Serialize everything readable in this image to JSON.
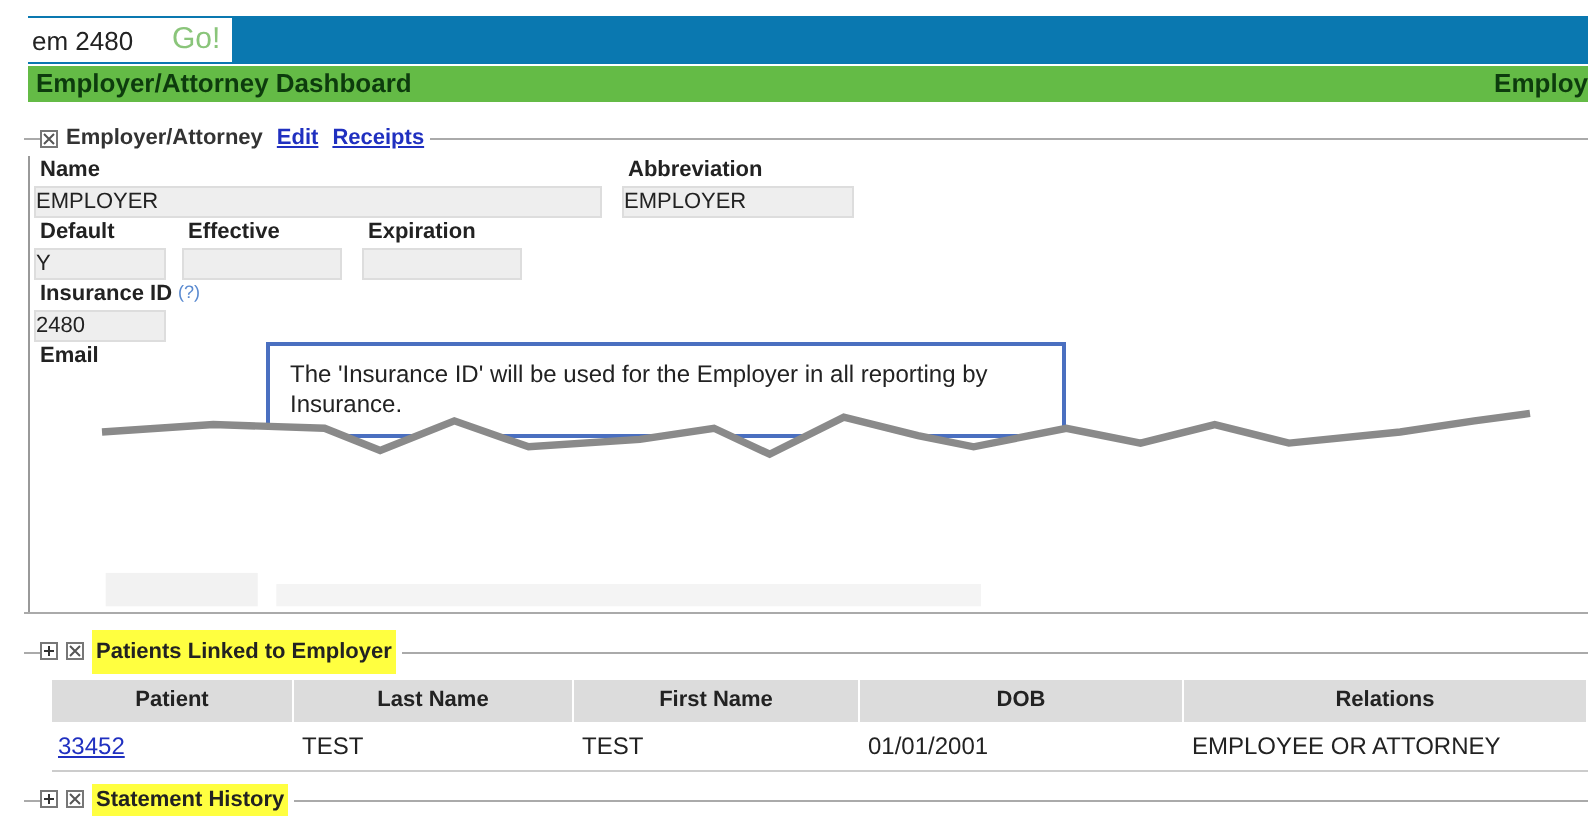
{
  "search": {
    "value": "em 2480",
    "button": "Go!"
  },
  "header": {
    "title": "Employer/Attorney Dashboard",
    "right_title": "Employ"
  },
  "employer_section": {
    "title": "Employer/Attorney",
    "links": [
      "Edit",
      "Receipts"
    ],
    "rows": [
      [
        {
          "kind": "field",
          "label": "Name",
          "value": "EMPLOYER"
        },
        {
          "kind": "field",
          "label": "Abbreviation",
          "value": "EMPLOYER"
        }
      ],
      [
        {
          "kind": "field",
          "label": "Default",
          "value": "Y"
        },
        {
          "kind": "field",
          "label": "Effective"
        },
        {
          "kind": "field",
          "label": "Expiration"
        }
      ],
      [
        {
          "kind": "field",
          "label": "Insurance ID",
          "help": "(?)",
          "value": "2480"
        }
      ],
      [
        {
          "kind": "label",
          "label": "Email"
        }
      ]
    ],
    "tooltip": "The 'Insurance ID' will be used for the Employer in all reporting by Insurance."
  },
  "patients_section": {
    "title": "Patients Linked to Employer",
    "columns": [
      "Patient",
      "Last Name",
      "First Name",
      "DOB",
      "Relations"
    ],
    "rows": [
      [
        "33452",
        "TEST",
        "TEST",
        "01/01/2001",
        "EMPLOYEE OR ATTORNEY"
      ]
    ]
  },
  "statement_section": {
    "title": "Statement History"
  }
}
